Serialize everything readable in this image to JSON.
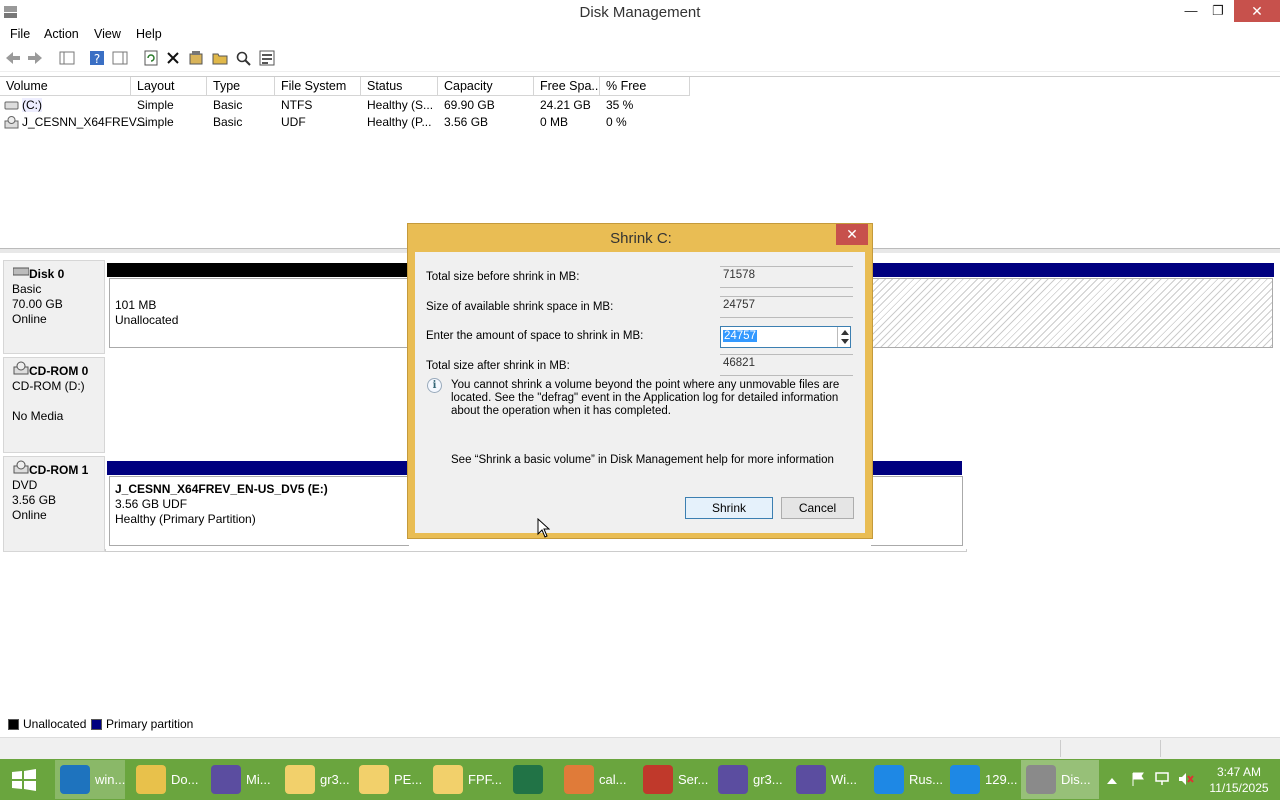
{
  "window": {
    "title": "Disk Management",
    "minimize": "—",
    "maximize": "❐",
    "close": "✕"
  },
  "menu": [
    "File",
    "Action",
    "View",
    "Help"
  ],
  "columns": [
    "Volume",
    "Layout",
    "Type",
    "File System",
    "Status",
    "Capacity",
    "Free Spa...",
    "% Free"
  ],
  "volumes": [
    {
      "volume": "(C:)",
      "layout": "Simple",
      "type": "Basic",
      "fs": "NTFS",
      "status": "Healthy (S...",
      "capacity": "69.90 GB",
      "free": "24.21 GB",
      "pct": "35 %"
    },
    {
      "volume": "J_CESNN_X64FREV...",
      "layout": "Simple",
      "type": "Basic",
      "fs": "UDF",
      "status": "Healthy (P...",
      "capacity": "3.56 GB",
      "free": "0 MB",
      "pct": "0 %"
    }
  ],
  "disks": [
    {
      "name": "Disk 0",
      "l1": "Basic",
      "l2": "70.00 GB",
      "l3": "Online",
      "part_size": "101 MB",
      "part_label": "Unallocated"
    },
    {
      "name": "CD-ROM 0",
      "l1": "CD-ROM (D:)",
      "l2": "",
      "l3": "No Media"
    },
    {
      "name": "CD-ROM 1",
      "l1": "DVD",
      "l2": "3.56 GB",
      "l3": "Online",
      "part_name": "J_CESNN_X64FREV_EN-US_DV5  (E:)",
      "part_size": "3.56 GB UDF",
      "part_status": "Healthy (Primary Partition)"
    }
  ],
  "legend": {
    "unallocated": "Unallocated",
    "primary": "Primary partition"
  },
  "colors": {
    "unallocated": "#000000",
    "primary": "#00007f",
    "dialog_frame": "#e9bd54",
    "taskbar": "#6aa53e",
    "close": "#c7514c"
  },
  "dialog": {
    "title": "Shrink C:",
    "close": "✕",
    "total_label": "Total size before shrink in MB:",
    "total_value": "71578",
    "avail_label": "Size of available shrink space in MB:",
    "avail_value": "24757",
    "enter_label": "Enter the amount of space to shrink in MB:",
    "enter_value": "24757",
    "after_label": "Total size after shrink in MB:",
    "after_value": "46821",
    "info_icon": "i",
    "info_text": "You cannot shrink a volume beyond the point where any unmovable files are located. See the \"defrag\" event in the Application log for detailed information about the operation when it has completed.",
    "help_text": "See “Shrink a basic volume” in Disk Management help for more information",
    "shrink_button": "Shrink",
    "cancel_button": "Cancel"
  },
  "taskbar": {
    "items": [
      {
        "label": "win...",
        "icon": "browser-icon",
        "color": "#1e73be"
      },
      {
        "label": "Do...",
        "icon": "folder-download-icon",
        "color": "#e8c14b"
      },
      {
        "label": "Mi...",
        "icon": "network-icon",
        "color": "#5b4da0"
      },
      {
        "label": "gr3...",
        "icon": "folder-icon",
        "color": "#f2d06b"
      },
      {
        "label": "PE...",
        "icon": "folder-icon",
        "color": "#f2d06b"
      },
      {
        "label": "FPF...",
        "icon": "folder-icon",
        "color": "#f2d06b"
      },
      {
        "label": "",
        "icon": "spreadsheet-icon",
        "color": "#217346"
      },
      {
        "label": "cal...",
        "icon": "calculator-icon",
        "color": "#e07b39"
      },
      {
        "label": "Ser...",
        "icon": "server-icon",
        "color": "#c0392b"
      },
      {
        "label": "gr3...",
        "icon": "network-icon",
        "color": "#5b4da0"
      },
      {
        "label": "Wi...",
        "icon": "network-icon",
        "color": "#5b4da0"
      },
      {
        "label": "Rus...",
        "icon": "sync-icon",
        "color": "#1e88e5"
      },
      {
        "label": "129...",
        "icon": "sync-icon",
        "color": "#1e88e5"
      },
      {
        "label": "Dis...",
        "icon": "disk-management-icon",
        "color": "#8a8a8a"
      }
    ],
    "time": "3:47 AM",
    "date": "11/15/2025"
  }
}
